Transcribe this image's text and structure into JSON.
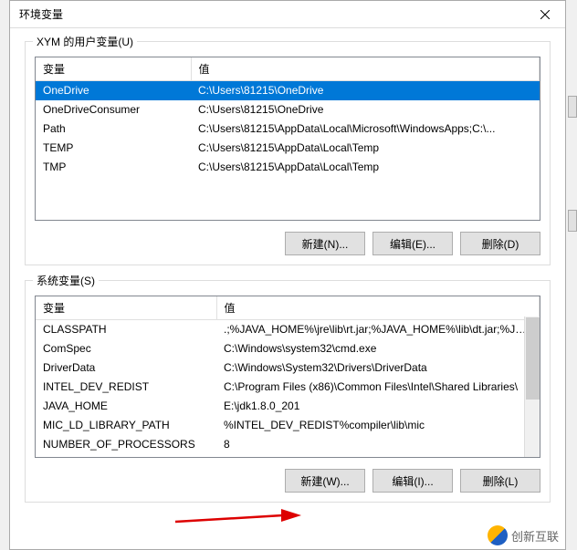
{
  "dialog": {
    "title": "环境变量"
  },
  "userVars": {
    "legend": "XYM 的用户变量(U)",
    "headers": {
      "name": "变量",
      "value": "值"
    },
    "rows": [
      {
        "name": "OneDrive",
        "value": "C:\\Users\\81215\\OneDrive",
        "selected": true
      },
      {
        "name": "OneDriveConsumer",
        "value": "C:\\Users\\81215\\OneDrive",
        "selected": false
      },
      {
        "name": "Path",
        "value": "C:\\Users\\81215\\AppData\\Local\\Microsoft\\WindowsApps;C:\\...",
        "selected": false
      },
      {
        "name": "TEMP",
        "value": "C:\\Users\\81215\\AppData\\Local\\Temp",
        "selected": false
      },
      {
        "name": "TMP",
        "value": "C:\\Users\\81215\\AppData\\Local\\Temp",
        "selected": false
      }
    ],
    "buttons": {
      "new": "新建(N)...",
      "edit": "编辑(E)...",
      "delete": "删除(D)"
    }
  },
  "sysVars": {
    "legend": "系统变量(S)",
    "headers": {
      "name": "变量",
      "value": "值"
    },
    "rows": [
      {
        "name": "CLASSPATH",
        "value": ".;%JAVA_HOME%\\jre\\lib\\rt.jar;%JAVA_HOME%\\lib\\dt.jar;%JAV..."
      },
      {
        "name": "ComSpec",
        "value": "C:\\Windows\\system32\\cmd.exe"
      },
      {
        "name": "DriverData",
        "value": "C:\\Windows\\System32\\Drivers\\DriverData"
      },
      {
        "name": "INTEL_DEV_REDIST",
        "value": "C:\\Program Files (x86)\\Common Files\\Intel\\Shared Libraries\\"
      },
      {
        "name": "JAVA_HOME",
        "value": "E:\\jdk1.8.0_201"
      },
      {
        "name": "MIC_LD_LIBRARY_PATH",
        "value": "%INTEL_DEV_REDIST%compiler\\lib\\mic"
      },
      {
        "name": "NUMBER_OF_PROCESSORS",
        "value": "8"
      }
    ],
    "buttons": {
      "new": "新建(W)...",
      "edit": "编辑(I)...",
      "delete": "删除(L)"
    }
  },
  "watermark": "创新互联"
}
